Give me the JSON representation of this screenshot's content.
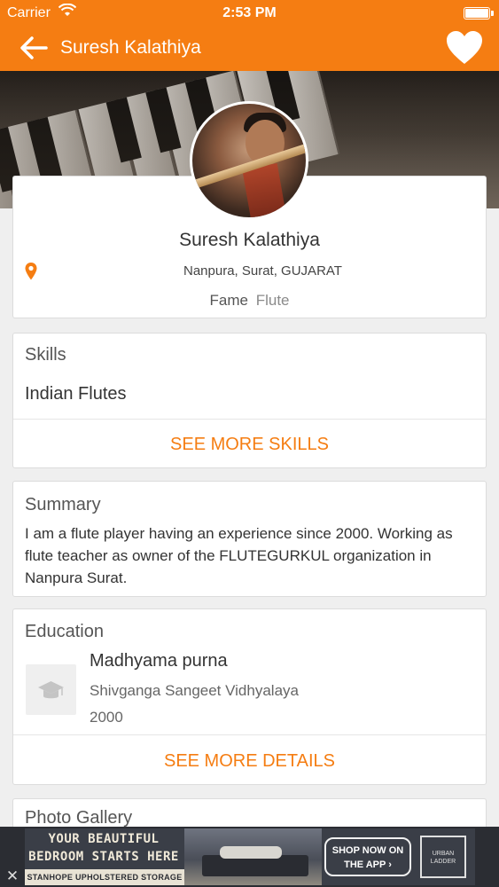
{
  "status_bar": {
    "carrier": "Carrier",
    "time": "2:53 PM"
  },
  "nav": {
    "title": "Suresh Kalathiya",
    "back_icon": "arrow-left-icon",
    "favorite_icon": "heart-icon"
  },
  "colors": {
    "accent": "#f57d12",
    "background": "#efefef",
    "card": "#ffffff"
  },
  "profile": {
    "name": "Suresh Kalathiya",
    "location": "Nanpura, Surat, GUJARAT",
    "fame_label": "Fame",
    "fame_value": "Flute"
  },
  "skills": {
    "title": "Skills",
    "items": [
      "Indian Flutes"
    ],
    "more_label": "SEE MORE SKILLS"
  },
  "summary": {
    "title": "Summary",
    "text": "I am a flute player having an experience since 2000. Working as flute teacher as owner of the FLUTEGURKUL organization in Nanpura Surat."
  },
  "education": {
    "title": "Education",
    "degree": "Madhyama purna",
    "school": "Shivganga Sangeet Vidhyalaya",
    "year": "2000",
    "more_label": "SEE MORE DETAILS"
  },
  "gallery": {
    "title": "Photo Gallery"
  },
  "ad": {
    "headline_line1": "YOUR BEAUTIFUL",
    "headline_line2": "BEDROOM STARTS HERE",
    "footer": "STANHOPE UPHOLSTERED STORAGE BED",
    "cta_line1": "SHOP NOW ON",
    "cta_line2": "THE APP ›",
    "brand_line1": "URBAN",
    "brand_line2": "LADDER",
    "close_label": "✕"
  }
}
